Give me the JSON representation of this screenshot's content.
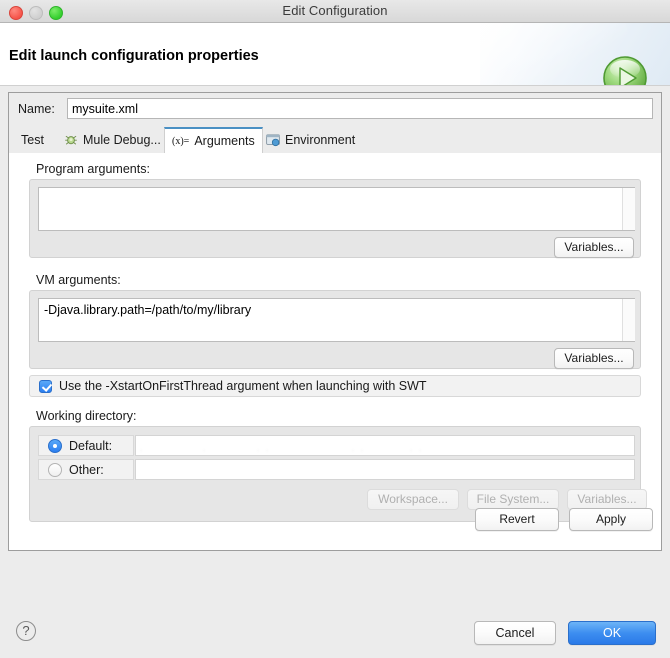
{
  "window": {
    "title": "Edit Configuration",
    "traffic_lights": [
      "close",
      "minimize",
      "zoom"
    ]
  },
  "header": {
    "title": "Edit launch configuration properties",
    "run_icon": "run-play-icon"
  },
  "name_field": {
    "label": "Name:",
    "value": "mysuite.xml",
    "placeholder": ""
  },
  "tabs": [
    {
      "id": "test",
      "label": "Test",
      "icon": "",
      "selected": false
    },
    {
      "id": "mule-debug",
      "label": "Mule Debug...",
      "icon": "bug-icon",
      "selected": false
    },
    {
      "id": "arguments",
      "label": "Arguments",
      "icon": "(x)=",
      "selected": true
    },
    {
      "id": "environment",
      "label": "Environment",
      "icon": "window-icon",
      "selected": false
    }
  ],
  "program_arguments": {
    "label": "Program arguments:",
    "value": "",
    "variables_button": "Variables..."
  },
  "vm_arguments": {
    "label": "VM arguments:",
    "value": "-Djava.library.path=/path/to/my/library",
    "variables_button": "Variables..."
  },
  "swt_checkbox": {
    "label": "Use the -XstartOnFirstThread argument when launching with SWT",
    "checked": true
  },
  "working_directory": {
    "label": "Working directory:",
    "default_radio": {
      "label": "Default:",
      "selected": true,
      "value": ""
    },
    "other_radio": {
      "label": "Other:",
      "selected": false,
      "value": ""
    },
    "buttons": [
      {
        "label": "Workspace...",
        "enabled": false
      },
      {
        "label": "File System...",
        "enabled": false
      },
      {
        "label": "Variables...",
        "enabled": false
      }
    ]
  },
  "panel_buttons": {
    "revert": "Revert",
    "apply": "Apply"
  },
  "dialog_buttons": {
    "help": "?",
    "cancel": "Cancel",
    "ok": "OK"
  },
  "colors": {
    "accent": "#2b7ef0",
    "tab_selected_border": "#4a90c4",
    "run_green": "#5fbf46",
    "close_red": "#f6544a",
    "zoom_green": "#35cf2e"
  }
}
